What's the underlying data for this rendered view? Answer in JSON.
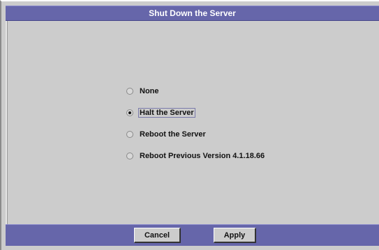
{
  "dialog": {
    "title": "Shut Down the Server"
  },
  "options": [
    {
      "label": "None",
      "selected": false
    },
    {
      "label": "Halt the Server",
      "selected": true
    },
    {
      "label": "Reboot the Server",
      "selected": false
    },
    {
      "label": "Reboot Previous Version 4.1.18.66",
      "selected": false
    }
  ],
  "buttons": {
    "cancel_label": "Cancel",
    "apply_label": "Apply"
  },
  "colors": {
    "titlebar": "#6666aa",
    "panel": "#cccccc"
  }
}
